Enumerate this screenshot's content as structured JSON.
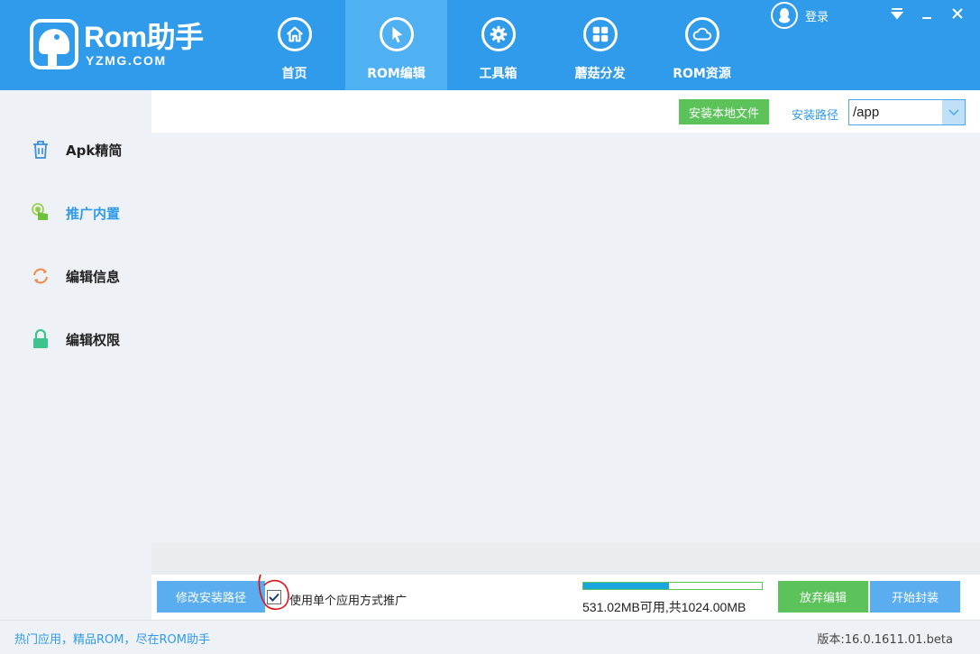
{
  "header": {
    "logo_main": "Rom助手",
    "logo_sub": "YZMG.COM",
    "login_label": "登录",
    "nav": [
      {
        "label": "首页",
        "icon": "home-icon"
      },
      {
        "label": "ROM编辑",
        "icon": "cursor-icon",
        "active": true
      },
      {
        "label": "工具箱",
        "icon": "gear-icon"
      },
      {
        "label": "蘑菇分发",
        "icon": "grid-icon"
      },
      {
        "label": "ROM资源",
        "icon": "cloud-icon"
      }
    ]
  },
  "sidebar": {
    "items": [
      {
        "label": "Apk精简",
        "icon": "trash-icon"
      },
      {
        "label": "推广内置",
        "icon": "touch-icon",
        "active": true
      },
      {
        "label": "编辑信息",
        "icon": "refresh-icon"
      },
      {
        "label": "编辑权限",
        "icon": "lock-icon"
      }
    ]
  },
  "toolbar": {
    "install_local_label": "安装本地文件",
    "install_path_label": "安装路径",
    "install_path_value": "/app"
  },
  "bottom": {
    "modify_path_label": "修改安装路径",
    "single_app_checkbox_label": "使用单个应用方式推广",
    "single_app_checked": true,
    "storage_text": "531.02MB可用,共1024.00MB",
    "storage_used_fraction": 0.48,
    "discard_label": "放弃编辑",
    "start_pack_label": "开始封装"
  },
  "footer": {
    "tagline": "热门应用，精品ROM，尽在ROM助手",
    "version": "版本:16.0.1611.01.beta"
  },
  "colors": {
    "brand_blue": "#2f9bea",
    "active_tab": "#4fb0f2",
    "green": "#5cc35a",
    "button_blue": "#5aaef0",
    "progress": "#1aa6dc",
    "annotation_red": "#e0101a"
  }
}
